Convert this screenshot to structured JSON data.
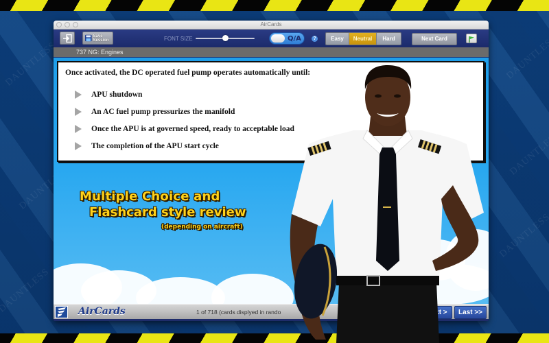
{
  "window": {
    "title": "AirCards"
  },
  "toolbar": {
    "exit_icon": "exit-icon",
    "save_session_label": "Save Session",
    "save_icon": "floppy-disk-icon",
    "font_size_label": "FONT SIZE",
    "font_size_value": 0.5,
    "qa_toggle_label": "Q/A",
    "help_icon": "question-mark-icon",
    "difficulty": [
      {
        "label": "Easy",
        "active": false
      },
      {
        "label": "Neutral",
        "active": true
      },
      {
        "label": "Hard",
        "active": false
      }
    ],
    "next_card_label": "Next Card",
    "flag_icon": "green-flag-icon"
  },
  "category": "737 NG: Engines",
  "question": {
    "text": "Once activated, the DC operated fuel pump operates automatically until:",
    "answers": [
      "APU shutdown",
      "An AC fuel pump pressurizes the manifold",
      "Once the APU is at governed speed, ready to acceptable load",
      "The completion of the APU start cycle"
    ]
  },
  "promo": {
    "line1": "Multiple Choice and",
    "line2": "Flashcard style review",
    "line3": "(depending on aircraft)"
  },
  "footer": {
    "logo_text": "AirCards",
    "card_count": "1 of 718 (cards displyed in rando",
    "next_label": "Next >",
    "last_label": "Last >>"
  },
  "background": {
    "watermark": "DAUNTLESS"
  },
  "colors": {
    "hazard_yellow": "#e9e514",
    "background_blue": "#0e3f7a",
    "active_difficulty": "#d9a315",
    "sky_blue": "#29a8f0",
    "nav_button_blue": "#3459b3"
  }
}
